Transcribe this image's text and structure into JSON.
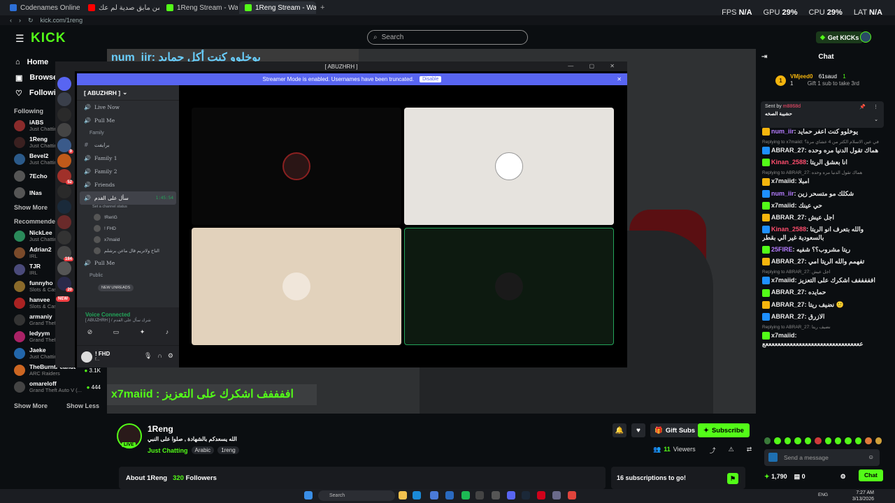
{
  "browser": {
    "tabs": [
      {
        "label": "Codenames Online",
        "color": "#2d6fd6"
      },
      {
        "label": "حظ من مابق صدية لم عك...",
        "color": "#ff0000"
      },
      {
        "label": "1Reng Stream - Watch Live",
        "color": "#53fc18"
      },
      {
        "label": "1Reng Stream - Watch Live",
        "color": "#53fc18"
      }
    ],
    "url": "kick.com/1reng",
    "perf": {
      "fps_label": "FPS",
      "fps": "N/A",
      "gpu_label": "GPU",
      "gpu": "29%",
      "cpu_label": "CPU",
      "cpu": "29%",
      "lat_label": "LAT",
      "lat": "N/A"
    }
  },
  "header": {
    "logo": "KICK",
    "search_placeholder": "Search",
    "get_kicks": "Get KICKs"
  },
  "sidebar": {
    "nav": [
      {
        "label": "Home",
        "icon": "home-icon"
      },
      {
        "label": "Browse",
        "icon": "browse-icon"
      },
      {
        "label": "Following",
        "icon": "heart-icon"
      }
    ],
    "following_title": "Following",
    "following": [
      {
        "name": "iABS",
        "cat": "Just Chatting",
        "color": "#8a2b2b"
      },
      {
        "name": "1Reng",
        "cat": "Just Chatting",
        "color": "#3a2020"
      },
      {
        "name": "Bevel2",
        "cat": "Just Chatting",
        "color": "#2b5a8a"
      },
      {
        "name": "7Echo",
        "cat": "",
        "color": "#555"
      },
      {
        "name": "INas",
        "cat": "",
        "color": "#555"
      }
    ],
    "show_more": "Show More",
    "recommended_title": "Recommended",
    "recommended": [
      {
        "name": "NickLee",
        "cat": "Just Chatting",
        "viewers": "",
        "color": "#2a8a5a"
      },
      {
        "name": "Adrian2",
        "cat": "IRL",
        "viewers": "",
        "color": "#7a4a2a"
      },
      {
        "name": "TJR",
        "cat": "IRL",
        "viewers": "",
        "color": "#4a4a7a"
      },
      {
        "name": "funnyho",
        "cat": "Slots & Casino",
        "viewers": "",
        "color": "#8a6a2a"
      },
      {
        "name": "hanvee",
        "cat": "Slots & Casino",
        "viewers": "",
        "color": "#aa2222"
      },
      {
        "name": "armaniy",
        "cat": "Grand Theft Auto V",
        "viewers": "",
        "color": "#333"
      },
      {
        "name": "ledyym",
        "cat": "Grand Theft Auto V",
        "viewers": "",
        "color": "#aa2266"
      },
      {
        "name": "Jaeke",
        "cat": "Just Chatting",
        "viewers": "",
        "color": "#2266aa"
      },
      {
        "name": "TheBurntPeanut",
        "cat": "ARC Raiders",
        "viewers": "3.1K",
        "color": "#cc6622"
      },
      {
        "name": "omareloff",
        "cat": "Grand Theft Auto V (...",
        "viewers": "444",
        "color": "#444"
      }
    ],
    "show_more2": "Show More",
    "show_less": "Show Less"
  },
  "video": {
    "overlay_top": "num_iir: يوخلوو كنت أكل حمايد",
    "overlay_bottom": "x7maiid : اففففف اشكرك على التعزيز"
  },
  "discord": {
    "title": "[ ABUZHRH ]",
    "banner": "Streamer Mode is enabled. Usernames have been truncated.",
    "banner_btn": "Disable",
    "server_name": "[ ABUZHRH ]",
    "channels": [
      {
        "type": "voice",
        "name": "Live Now"
      },
      {
        "type": "voice",
        "name": "Pull Me"
      },
      {
        "type": "cat",
        "name": "Family"
      },
      {
        "type": "text",
        "name": "برايفت"
      },
      {
        "type": "voice",
        "name": "Family 1"
      },
      {
        "type": "voice",
        "name": "Family 2"
      },
      {
        "type": "voice",
        "name": "Friends"
      }
    ],
    "active_channel": "سأل على القدم",
    "active_time": "1:45:54",
    "channel_status": "Set a channel status",
    "voice_users": [
      "!ReriG",
      "! FHD",
      "x7maiid",
      "الناخ ولاتريم قال ماعن برشلم"
    ],
    "channels2": [
      {
        "type": "voice",
        "name": "Pull Me"
      },
      {
        "type": "cat",
        "name": "Public"
      }
    ],
    "new_unreads": "NEW UNREADS",
    "new_badge": "NEW",
    "voice_connected": "Voice Connected",
    "voice_channel": "[ ABUZHRH ] / شرك سأل على القدم",
    "user_name": "! FHD",
    "user_status": "f...",
    "server_badges": [
      "",
      "",
      "",
      "",
      "9",
      "",
      "52",
      "",
      "",
      "",
      "",
      "184",
      "",
      "20"
    ]
  },
  "stream": {
    "name": "1Reng",
    "live": "LIVE",
    "title": "الله يسعدكم بالشهادة , صلوا على النبي",
    "category": "Just Chatting",
    "tags": [
      "Arabic",
      "1reng"
    ],
    "gift_subs": "Gift Subs",
    "subscribe": "Subscribe",
    "viewers": "11",
    "viewers_label": "Viewers",
    "about": "About 1Reng",
    "followers": "320",
    "followers_label": "Followers",
    "sub_goal": "16 subscriptions to go!"
  },
  "chat": {
    "title": "Chat",
    "gifter": "VMjeed0",
    "gifter_count": "1",
    "gift_target": "61saud",
    "gift_target_count": "1",
    "gift_note": "Gift 1 sub to take 3rd",
    "pinned_by_label": "Sent by",
    "pinned_by": "m8868d",
    "pinned_text": "حشيبة الصخه",
    "messages": [
      {
        "reply": "",
        "user": "num_iir",
        "color": "#b57cff",
        "text": "يوخلوو كنت اعفر حمايد"
      },
      {
        "reply": "Replying to x7maiid: في عين الاسلام الكثر من 4 عشاي مرة؟",
        "user": "ABRAR_27",
        "color": "#e8e8e8",
        "text": "هماك تقول الدنيا مره وحده"
      },
      {
        "reply": "",
        "user": "Kinan_2588",
        "color": "#ff4d6d",
        "text": "انا بعشق الريتا"
      },
      {
        "reply": "Replying to ABRAR_27: هماك تقول الدنيا مره وحده",
        "user": "x7maiid",
        "color": "#e8e8e8",
        "text": "امبلا"
      },
      {
        "reply": "",
        "user": "num_iir",
        "color": "#b57cff",
        "text": "شكلك مو متسحر زين"
      },
      {
        "reply": "",
        "user": "x7maiid",
        "color": "#e8e8e8",
        "text": "حي عينك"
      },
      {
        "reply": "",
        "user": "ABRAR_27",
        "color": "#e8e8e8",
        "text": "اجل عيش"
      },
      {
        "reply": "",
        "user": "Kinan_2588",
        "color": "#ff4d6d",
        "text": "والله بتعرف انو الريتا بالسعودية غير الي بقطر"
      },
      {
        "reply": "",
        "user": "25FIRE",
        "color": "#b57cff",
        "text": "ريتا مشروب؟؟ شفيه"
      },
      {
        "reply": "",
        "user": "ABRAR_27",
        "color": "#e8e8e8",
        "text": "تفهمم والله الريتا امي"
      },
      {
        "reply": "Replying to ABRAR_27: اجل عيش",
        "user": "x7maiid",
        "color": "#e8e8e8",
        "text": "افففففف اشكرك على التعزيز"
      },
      {
        "reply": "",
        "user": "ABRAR_27",
        "color": "#e8e8e8",
        "text": "حمايده"
      },
      {
        "reply": "",
        "user": "ABRAR_27",
        "color": "#e8e8e8",
        "text": "نضيف ريتا 🙂"
      },
      {
        "reply": "",
        "user": "ABRAR_27",
        "color": "#e8e8e8",
        "text": "الازرق"
      },
      {
        "reply": "Replying to ABRAR_27: نضيف ريتا",
        "user": "x7maiid",
        "color": "#e8e8e8",
        "text": "ععععععععععععععععععععععععععععععععع"
      }
    ],
    "placeholder": "Send a message",
    "points": "1,790",
    "count2": "0",
    "send": "Chat"
  },
  "taskbar": {
    "search": "Search",
    "lang": "ENG",
    "time": "7:27 AM",
    "date": "3/13/2026"
  }
}
